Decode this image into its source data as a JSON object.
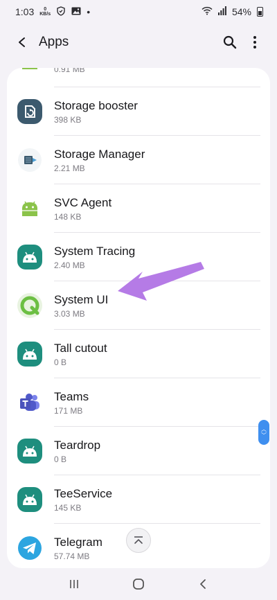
{
  "status_bar": {
    "time": "1:03",
    "net_speed_value": "0",
    "net_speed_unit": "KB/s",
    "battery": "54%"
  },
  "app_bar": {
    "title": "Apps",
    "icons": [
      "back-arrow-icon",
      "search-icon",
      "more-vert-icon"
    ]
  },
  "apps": [
    {
      "name": "",
      "size": "0.91 MB",
      "icon": "android-green-icon"
    },
    {
      "name": "Storage booster",
      "size": "398 KB",
      "icon": "storage-booster-icon"
    },
    {
      "name": "Storage Manager",
      "size": "2.21 MB",
      "icon": "storage-manager-icon"
    },
    {
      "name": "SVC Agent",
      "size": "148 KB",
      "icon": "android-green-icon"
    },
    {
      "name": "System Tracing",
      "size": "2.40 MB",
      "icon": "android-teal-icon"
    },
    {
      "name": "System UI",
      "size": "3.03 MB",
      "icon": "android-q-icon"
    },
    {
      "name": "Tall cutout",
      "size": "0 B",
      "icon": "android-teal-icon"
    },
    {
      "name": "Teams",
      "size": "171 MB",
      "icon": "teams-icon"
    },
    {
      "name": "Teardrop",
      "size": "0 B",
      "icon": "android-teal-icon"
    },
    {
      "name": "TeeService",
      "size": "145 KB",
      "icon": "android-teal-icon"
    },
    {
      "name": "Telegram",
      "size": "57.74 MB",
      "icon": "telegram-icon"
    }
  ],
  "colors": {
    "background": "#f4f2f7",
    "card": "#ffffff",
    "android_teal": "#1e8e7e",
    "android_green": "#8bc34a",
    "annotation_arrow": "#b57be6",
    "scroll_thumb": "#3f8fef"
  },
  "nav": {
    "icons": [
      "recents-icon",
      "home-icon",
      "back-nav-icon"
    ]
  }
}
